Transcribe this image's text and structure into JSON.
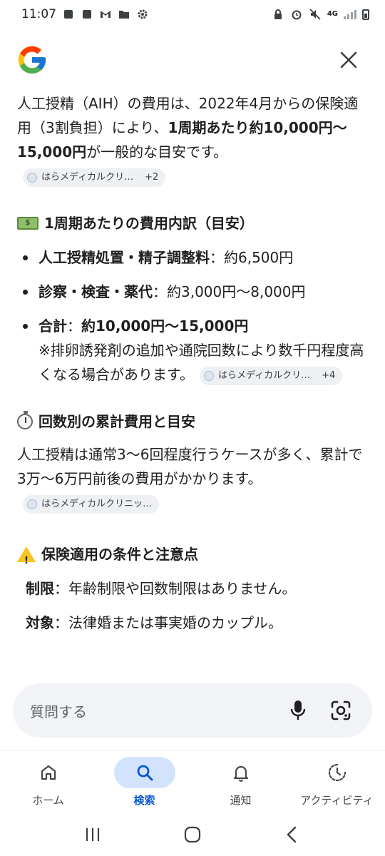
{
  "status_bar": {
    "time": "11:07",
    "network": "4G"
  },
  "header": {
    "logo": "google-g-logo",
    "close_icon": "close-icon"
  },
  "content": {
    "intro": {
      "t1": "人工授精（AIH）の費用は、2022年4月からの保険適用（3割負担）により、",
      "b1": "1周期あたり約10,000円〜15,000円",
      "t2": "が一般的な目安です。",
      "chip_label": "はらメディカルクリ…",
      "chip_count": "+2"
    },
    "section1": {
      "title": "1周期あたりの費用内訳（目安）",
      "items": [
        {
          "label": "人工授精処置・精子調整料",
          "sep": "：",
          "value": "約6,500円"
        },
        {
          "label": "診察・検査・薬代",
          "sep": "：",
          "value": "約3,000円〜8,000円"
        },
        {
          "label": "合計",
          "sep": "：",
          "value": "約10,000円〜15,000円",
          "note": "※排卵誘発剤の追加や通院回数により数千円程度高くなる場合があります。",
          "chip_label": "はらメディカルクリ…",
          "chip_count": "+4"
        }
      ]
    },
    "section2": {
      "title": "回数別の累計費用と目安",
      "text": "人工授精は通常3〜6回程度行うケースが多く、累計で3万〜6万円前後の費用がかかります。",
      "chip_label": "はらメディカルクリニッ…"
    },
    "section3": {
      "title": "保険適用の条件と注意点",
      "items": [
        {
          "label": "制限",
          "sep": "：",
          "value": "年齢制限や回数制限はありません。"
        },
        {
          "label": "対象",
          "sep": "：",
          "value": "法律婚または事実婚のカップル。"
        }
      ]
    }
  },
  "search": {
    "placeholder": "質問する"
  },
  "bottom_nav": {
    "items": [
      {
        "label": "ホーム",
        "icon": "home-icon"
      },
      {
        "label": "検索",
        "icon": "search-icon",
        "active": true
      },
      {
        "label": "通知",
        "icon": "bell-icon"
      },
      {
        "label": "アクティビティ",
        "icon": "activity-icon"
      }
    ]
  },
  "colors": {
    "accent": "#0b57d0",
    "active_pill": "#d3e3fd",
    "search_bg": "#f1f3f6",
    "chip_bg": "#eef0f3"
  }
}
